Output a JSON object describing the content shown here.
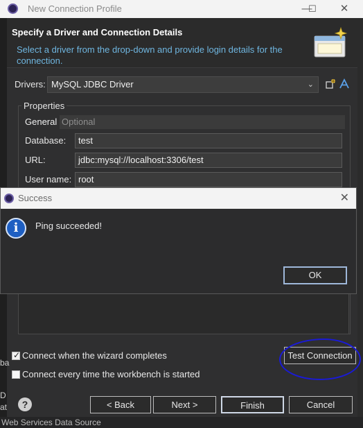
{
  "window": {
    "title": "New Connection Profile",
    "controls": {
      "minimize": "—",
      "maximize": "☐",
      "close": "✕"
    }
  },
  "banner": {
    "heading": "Specify a Driver and Connection Details",
    "description": "Select a driver from the drop-down and provide login details for the connection."
  },
  "drivers": {
    "label": "Drivers:",
    "selected": "MySQL JDBC Driver"
  },
  "properties": {
    "legend": "Properties",
    "tabs": [
      {
        "label": "General"
      },
      {
        "label": "Optional"
      }
    ],
    "fields": [
      {
        "label": "Database:",
        "value": "test"
      },
      {
        "label": "URL:",
        "value": "jdbc:mysql://localhost:3306/test"
      },
      {
        "label": "User name:",
        "value": "root"
      }
    ]
  },
  "options": {
    "connect_on_finish": {
      "label": "Connect when the wizard completes",
      "checked": true
    },
    "connect_on_start": {
      "label": "Connect every time the workbench is started",
      "checked": false
    }
  },
  "buttons": {
    "test_connection": "Test Connection",
    "back": "< Back",
    "next": "Next >",
    "finish": "Finish",
    "cancel": "Cancel",
    "help": "?"
  },
  "success_dialog": {
    "title": "Success",
    "message": "Ping succeeded!",
    "ok": "OK",
    "close": "✕"
  },
  "background": {
    "left_fragments": [
      "ba",
      "D",
      "at"
    ],
    "bottom_text": "Web Services Data Source"
  },
  "colors": {
    "accent_link": "#6fb6e0",
    "annotation": "#1a1ad6",
    "info_blue": "#1e5fc2"
  }
}
